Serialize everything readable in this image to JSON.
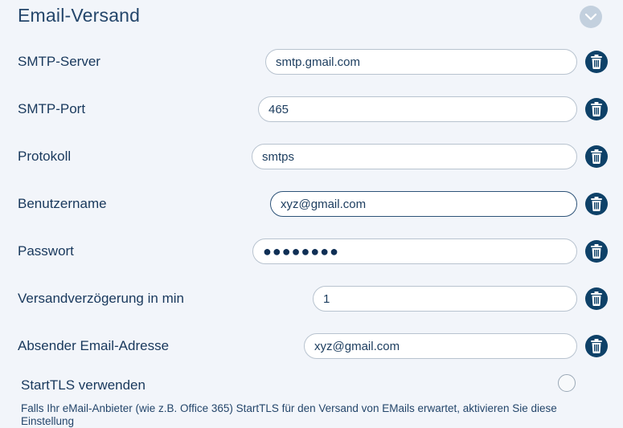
{
  "section": {
    "title": "Email-Versand",
    "collapse_icon": "chevron-down-icon"
  },
  "fields": [
    {
      "key": "smtp_server",
      "label": "SMTP-Server",
      "value": "smtp.gmail.com"
    },
    {
      "key": "smtp_port",
      "label": "SMTP-Port",
      "value": "465"
    },
    {
      "key": "protocol",
      "label": "Protokoll",
      "value": "smtps"
    },
    {
      "key": "username",
      "label": "Benutzername",
      "value": "xyz@gmail.com"
    },
    {
      "key": "password",
      "label": "Passwort",
      "value": "●●●●●●●●"
    },
    {
      "key": "delay",
      "label": "Versandverzögerung in min",
      "value": "1"
    },
    {
      "key": "sender",
      "label": "Absender Email-Adresse",
      "value": "xyz@gmail.com"
    }
  ],
  "delete_icon": "trash-icon",
  "starttls": {
    "label": "StartTLS verwenden",
    "checked": false,
    "hint": "Falls Ihr eMail-Anbieter (wie z.B. Office 365) StartTLS für den Versand von EMails erwartet, aktivieren Sie diese Einstellung"
  },
  "colors": {
    "accent": "#0e4168",
    "text": "#18385c",
    "background": "#f2f5fa",
    "input_border": "#b8c3cf"
  }
}
